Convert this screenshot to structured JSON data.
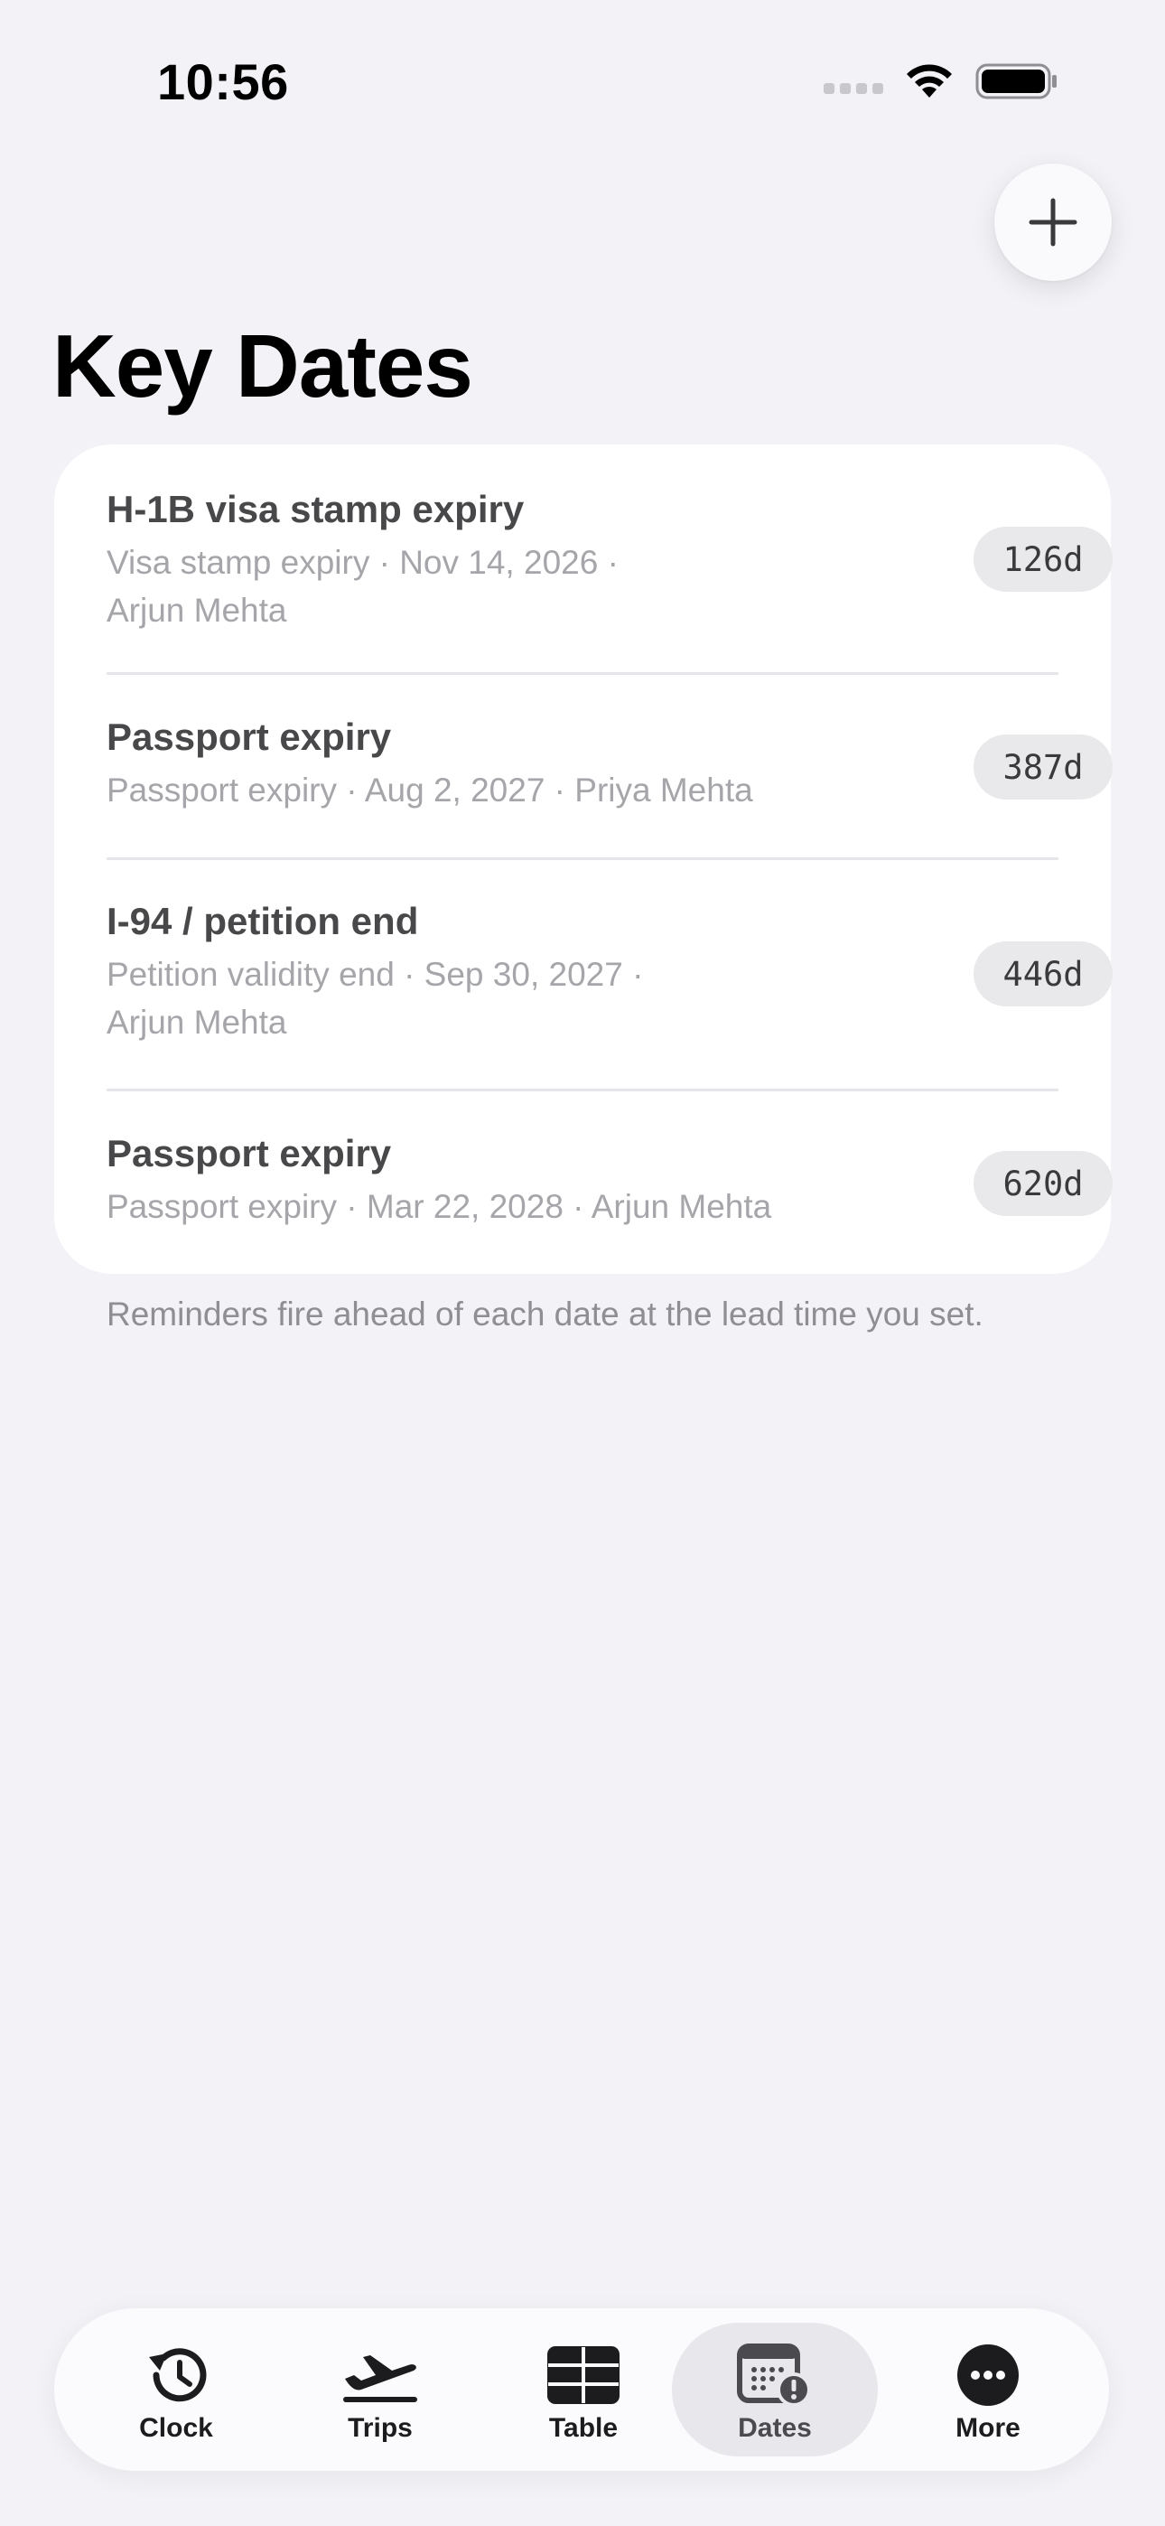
{
  "status_bar": {
    "time": "10:56"
  },
  "header": {
    "title": "Key Dates",
    "add_icon": "plus-icon"
  },
  "dates": [
    {
      "title": "H-1B visa stamp expiry",
      "line1": "Visa stamp expiry · Nov 14, 2026 ·",
      "line2": "Arjun Mehta",
      "days": "126d"
    },
    {
      "title": "Passport expiry",
      "line1": "Passport expiry · Aug 2, 2027 · Priya Mehta",
      "line2": "",
      "days": "387d"
    },
    {
      "title": "I-94 / petition end",
      "line1": "Petition validity end · Sep 30, 2027 ·",
      "line2": "Arjun Mehta",
      "days": "446d"
    },
    {
      "title": "Passport expiry",
      "line1": "Passport expiry · Mar 22, 2028 · Arjun Mehta",
      "line2": "",
      "days": "620d"
    }
  ],
  "footnote": "Reminders fire ahead of each date at the lead time you set.",
  "tab_bar": {
    "tabs": [
      {
        "label": "Clock",
        "icon": "clock-history-icon",
        "active": false
      },
      {
        "label": "Trips",
        "icon": "airplane-departure-icon",
        "active": false
      },
      {
        "label": "Table",
        "icon": "table-icon",
        "active": false
      },
      {
        "label": "Dates",
        "icon": "calendar-alert-icon",
        "active": true
      },
      {
        "label": "More",
        "icon": "more-icon",
        "active": false
      }
    ]
  },
  "colors": {
    "background": "#f2f2f7",
    "card": "#ffffff",
    "title_text": "#000000",
    "row_title": "#48484a",
    "row_subtitle": "#a5a5aa",
    "badge_bg": "#e9e9ec",
    "active_tab_bg": "#e7e7ec"
  }
}
